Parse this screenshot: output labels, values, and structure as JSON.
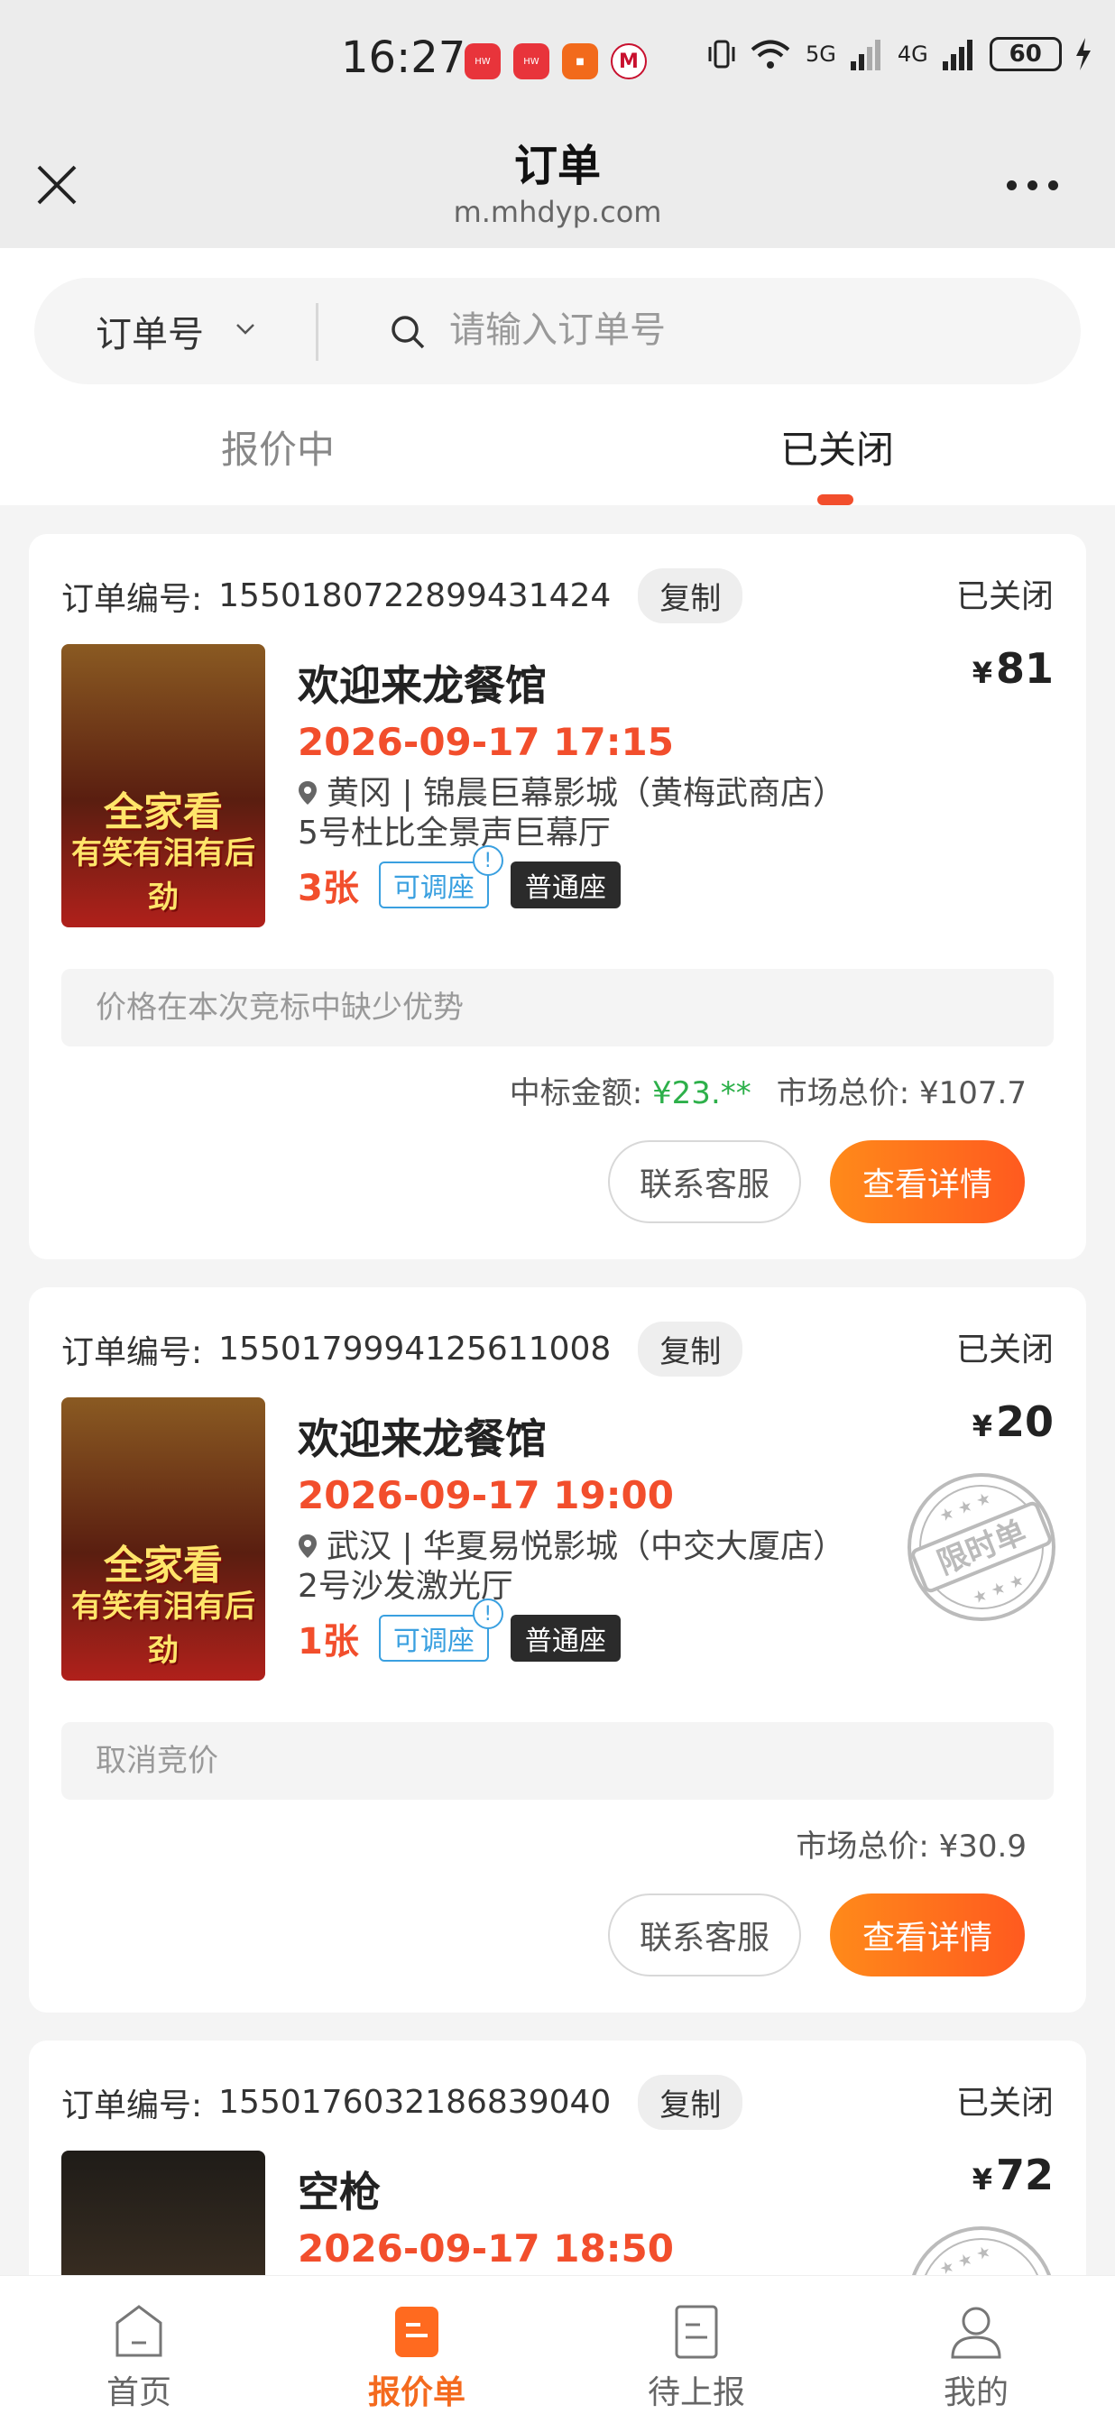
{
  "status_bar": {
    "time": "16:27",
    "network": "5G",
    "network2": "4G",
    "battery": "60"
  },
  "nav": {
    "title": "订单",
    "subtitle": "m.mhdyp.com"
  },
  "search": {
    "type_label": "订单号",
    "placeholder": "请输入订单号"
  },
  "tabs": [
    {
      "label": "报价中"
    },
    {
      "label": "已关闭"
    }
  ],
  "orders": [
    {
      "order_label": "订单编号:",
      "order_no": "1550180722899431424",
      "copy": "复制",
      "status": "已关闭",
      "movie": "欢迎来龙餐馆",
      "price_symbol": "¥",
      "price": "81",
      "showtime": "2026-09-17 17:15",
      "cinema_line1": "黄冈 | 锦晨巨幕影城（黄梅武商店）",
      "cinema_line2": "5号杜比全景声巨幕厅",
      "qty": "3张",
      "tag_adjust": "可调座",
      "tag_seat": "普通座",
      "note": "价格在本次竞标中缺少优势",
      "win_label": "中标金额:",
      "win_value": "¥23.**",
      "market_label": "市场总价:",
      "market_value": "¥107.7",
      "btn_service": "联系客服",
      "btn_detail": "查看详情",
      "poster_line1": "全家看",
      "poster_line2": "有笑有泪有后劲"
    },
    {
      "order_label": "订单编号:",
      "order_no": "1550179994125611008",
      "copy": "复制",
      "status": "已关闭",
      "movie": "欢迎来龙餐馆",
      "price_symbol": "¥",
      "price": "20",
      "showtime": "2026-09-17 19:00",
      "cinema_line1": "武汉 | 华夏易悦影城（中交大厦店）",
      "cinema_line2": "2号沙发激光厅",
      "qty": "1张",
      "tag_adjust": "可调座",
      "tag_seat": "普通座",
      "note": "取消竞价",
      "market_label": "市场总价:",
      "market_value": "¥30.9",
      "btn_service": "联系客服",
      "btn_detail": "查看详情",
      "stamp": "限时单",
      "poster_line1": "全家看",
      "poster_line2": "有笑有泪有后劲"
    },
    {
      "order_label": "订单编号:",
      "order_no": "1550176032186839040",
      "copy": "复制",
      "status": "已关闭",
      "movie": "空枪",
      "price_symbol": "¥",
      "price": "72",
      "showtime": "2026-09-17 18:50"
    }
  ],
  "tabbar": [
    {
      "label": "首页"
    },
    {
      "label": "报价单"
    },
    {
      "label": "待上报"
    },
    {
      "label": "我的"
    }
  ],
  "colors": {
    "accent": "#f24e2c",
    "orange": "#ff6a1f",
    "green": "#2db04a",
    "blue_tag": "#3aa0e0"
  }
}
